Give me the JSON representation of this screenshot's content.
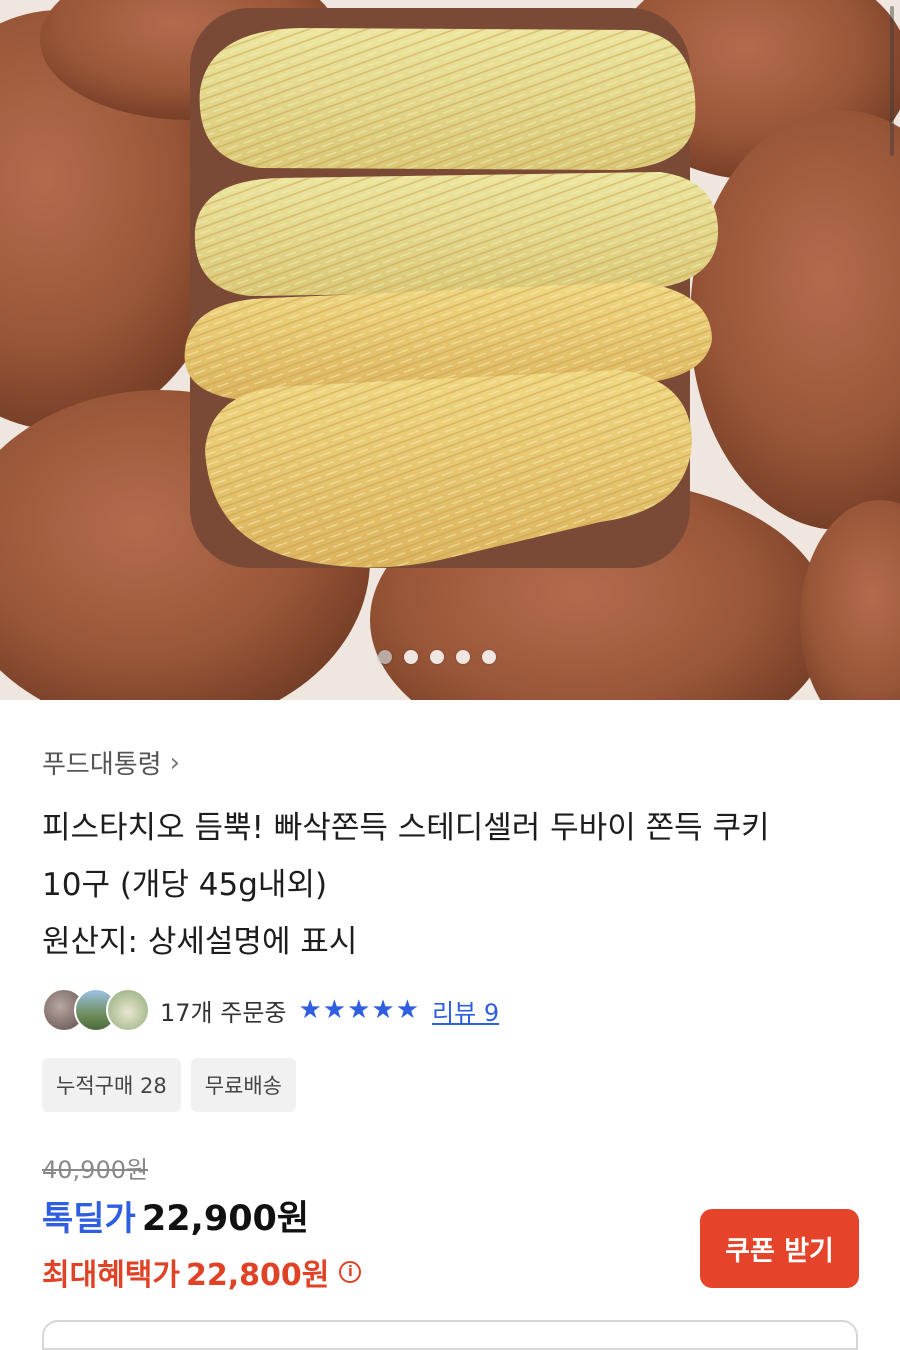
{
  "hero": {
    "image_alt": "pistachio-dubai-chewy-cookie-photo",
    "total_slides": 5,
    "active_slide": 1
  },
  "seller": {
    "name": "푸드대통령",
    "chevron": "›"
  },
  "product": {
    "title_line1": "피스타치오 듬뿍! 빠삭쫀득 스테디셀러 두바이 쫀득 쿠키",
    "title_line2": "10구 (개당 45g내외)",
    "origin": "원산지: 상세설명에 표시"
  },
  "stats": {
    "orders": "17개 주문중",
    "stars": "★★★★★",
    "rating": 5,
    "review_label": "리뷰 9"
  },
  "tags": [
    "누적구매 28",
    "무료배송"
  ],
  "price": {
    "original": "40,900원",
    "deal_label": "톡딜가",
    "deal_price": "22,900원",
    "max_label": "최대혜택가",
    "max_price": "22,800원",
    "info_icon": "i"
  },
  "buttons": {
    "coupon": "쿠폰 받기"
  },
  "colors": {
    "accent_blue": "#2f5fe0",
    "accent_red": "#e5442b"
  }
}
